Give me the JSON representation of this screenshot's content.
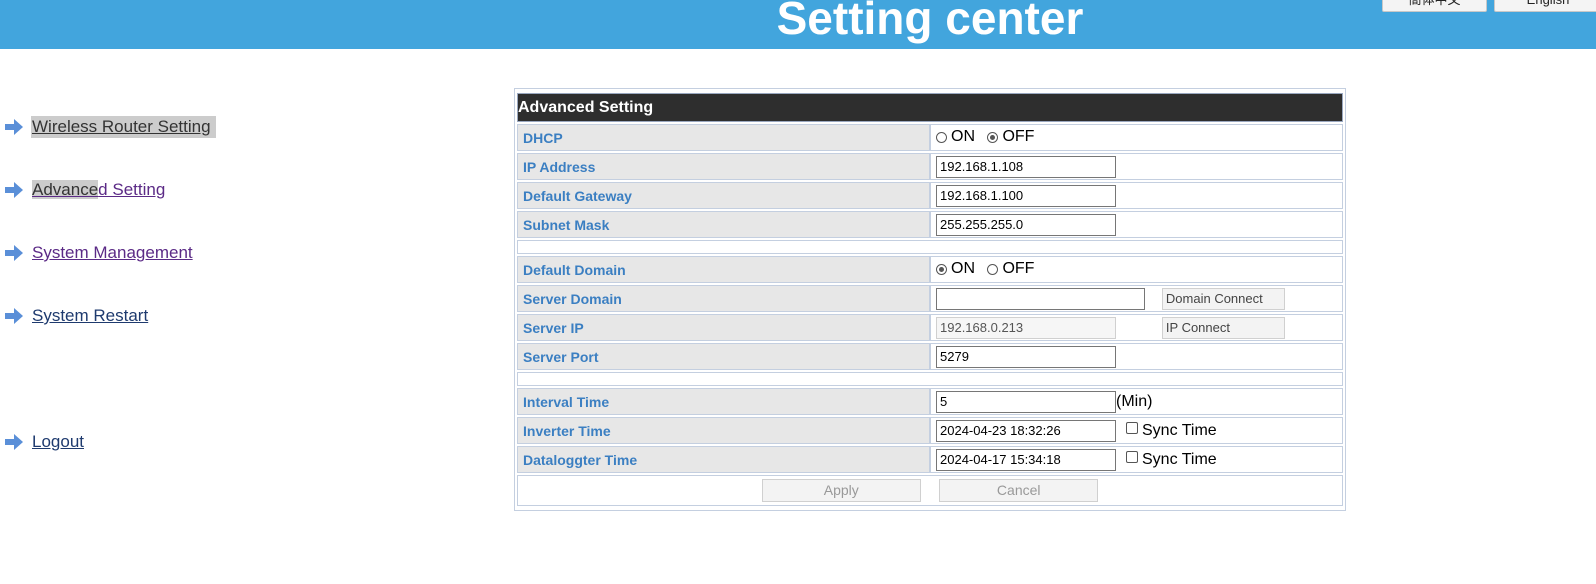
{
  "header": {
    "title": "Setting center",
    "lang_cn": "簡体中文",
    "lang_en": "English"
  },
  "sidebar": {
    "items": [
      {
        "label": "Wireless Router Setting"
      },
      {
        "label_part1": "Advance",
        "label_part2": "d Setting"
      },
      {
        "label": "System Management"
      },
      {
        "label": "System Restart"
      },
      {
        "label": "Logout"
      }
    ]
  },
  "panel": {
    "title": "Advanced Setting",
    "dhcp": {
      "label": "DHCP",
      "on": "ON",
      "off": "OFF",
      "selected": "OFF"
    },
    "ip_address": {
      "label": "IP Address",
      "value": "192.168.1.108"
    },
    "default_gateway": {
      "label": "Default Gateway",
      "value": "192.168.1.100"
    },
    "subnet_mask": {
      "label": "Subnet Mask",
      "value": "255.255.255.0"
    },
    "default_domain": {
      "label": "Default Domain",
      "on": "ON",
      "off": "OFF",
      "selected": "ON"
    },
    "server_domain": {
      "label": "Server Domain",
      "value": "",
      "button": "Domain Connect"
    },
    "server_ip": {
      "label": "Server IP",
      "value": "192.168.0.213",
      "button": "IP Connect"
    },
    "server_port": {
      "label": "Server Port",
      "value": "5279"
    },
    "interval_time": {
      "label": "Interval Time",
      "value": "5",
      "unit": "(Min)"
    },
    "inverter_time": {
      "label": "Inverter Time",
      "value": "2024-04-23 18:32:26",
      "sync_label": "Sync Time"
    },
    "datalogger_time": {
      "label": "Dataloggter Time",
      "value": "2024-04-17 15:34:18",
      "sync_label": "Sync Time"
    },
    "apply_label": "Apply",
    "cancel_label": "Cancel"
  },
  "colors": {
    "header_bg": "#42a5dd",
    "label_text": "#3b7fc2",
    "title_bar": "#2e2e2e",
    "nav_arrow": "#5a8fd8"
  },
  "icons": {
    "nav_arrow": "right-arrow-icon"
  }
}
